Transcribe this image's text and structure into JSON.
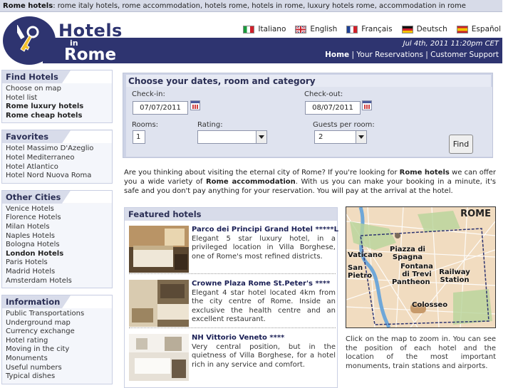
{
  "topbar": {
    "bold": "Rome hotels",
    "keywords": ": rome italy hotels, rome accommodation, hotels rome, hotels in rome, luxury hotels rome, accommodation in rome"
  },
  "logo": {
    "line1": "Hotels",
    "line2": "in",
    "line3": "Rome"
  },
  "languages": [
    {
      "label": "Italiano",
      "icon": "italy-flag-icon"
    },
    {
      "label": "English",
      "icon": "uk-flag-icon"
    },
    {
      "label": "Français",
      "icon": "france-flag-icon"
    },
    {
      "label": "Deutsch",
      "icon": "germany-flag-icon"
    },
    {
      "label": "Español",
      "icon": "spain-flag-icon"
    }
  ],
  "header": {
    "date": "Jul 4th, 2011 11:20pm CET",
    "nav": {
      "home": "Home",
      "reservations": "Your Reservations",
      "support": "Customer Support",
      "sep": " | "
    }
  },
  "sidebar": {
    "find": {
      "title": "Find Hotels",
      "items": [
        "Choose on map",
        "Hotel list",
        "Rome luxury hotels",
        "Rome cheap hotels"
      ]
    },
    "favorites": {
      "title": "Favorites",
      "items": [
        "Hotel Massimo D'Azeglio",
        "Hotel Mediterraneo",
        "Hotel Atlantico",
        "Hotel Nord Nuova Roma"
      ]
    },
    "cities": {
      "title": "Other Cities",
      "items": [
        "Venice Hotels",
        "Florence Hotels",
        "Milan Hotels",
        "Naples Hotels",
        "Bologna Hotels",
        "London Hotels",
        "Paris Hotels",
        "Madrid Hotels",
        "Amsterdam Hotels"
      ]
    },
    "info": {
      "title": "Information",
      "items": [
        "Public Transportations",
        "Underground map",
        "Currency exchange",
        "Hotel rating",
        "Moving in the city",
        "Monuments",
        "Useful numbers",
        "Typical dishes"
      ]
    }
  },
  "search": {
    "title": "Choose your dates, room and category",
    "checkin_label": "Check-in:",
    "checkin_value": "07/07/2011",
    "checkout_label": "Check-out:",
    "checkout_value": "08/07/2011",
    "rooms_label": "Rooms:",
    "rooms_value": "1",
    "rating_label": "Rating:",
    "rating_value": "",
    "guests_label": "Guests per room:",
    "guests_value": "2",
    "find_label": "Find"
  },
  "intro": {
    "t1": "Are you thinking about visiting the eternal city of Rome? If you're looking for ",
    "b1": "Rome hotels",
    "t2": " we can offer you a wide variety of ",
    "b2": "Rome accommodation",
    "t3": ". With us you can make your booking in a minute, it's safe and you don't pay anything for your reservation. You will pay at the arrival at the hotel."
  },
  "featured": {
    "title": "Featured hotels",
    "hotels": [
      {
        "name": "Parco dei Principi Grand Hotel *****L",
        "desc": "Elegant 5 star luxury hotel, in a privileged location in Villa Borghese, one of Rome's most refined districts."
      },
      {
        "name": "Crowne Plaza Rome St.Peter's ****",
        "desc": "Elegant 4 star hotel located 4km from the city centre of Rome. Inside an exclusive the health centre and an excellent restaurant."
      },
      {
        "name": "NH Vittorio Veneto ****",
        "desc": "Very central position, but in the quietness of Villa Borghese, for a hotel rich in any service and comfort."
      }
    ]
  },
  "map": {
    "title": "ROME",
    "labels": [
      "Vaticano",
      "San Pietro",
      "Piazza di Spagna",
      "Fontana di Trevi",
      "Pantheon",
      "Railway Station",
      "Colosseo"
    ],
    "caption": "Click on the map to zoom in. You can see the position of each hotel and the location of the most important monuments, train stations and airports."
  },
  "colors": {
    "brand": "#2e3470",
    "panel": "#d8dcea"
  }
}
